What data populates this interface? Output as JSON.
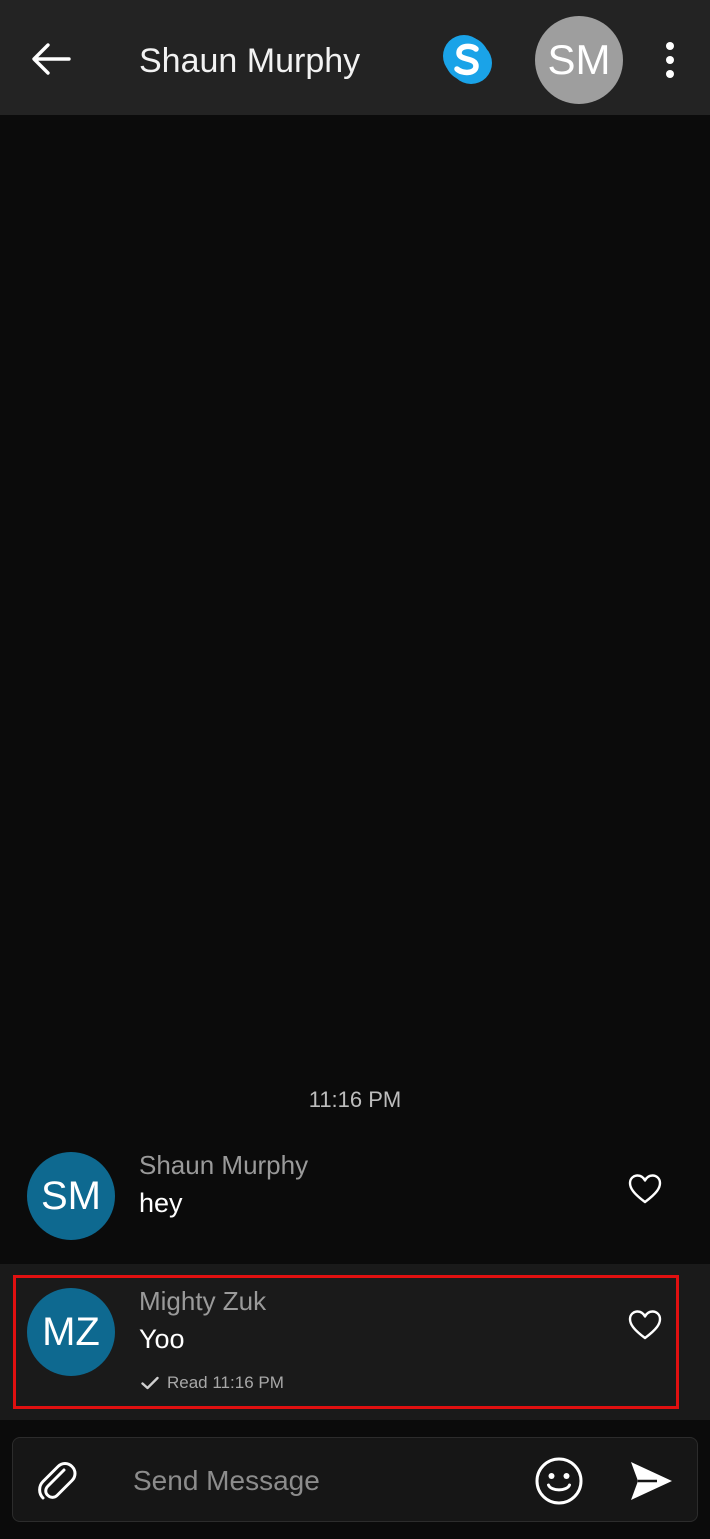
{
  "header": {
    "back_icon": "arrow-left-icon",
    "title": "Shaun Murphy",
    "skype_icon": "skype-logo-icon",
    "avatar_initials": "SM",
    "more_icon": "more-vertical-icon"
  },
  "conversation": {
    "time_divider": "11:16 PM",
    "messages": [
      {
        "sender": "Shaun Murphy",
        "avatar_initials": "SM",
        "text": "hey",
        "reaction_icon": "heart-outline-icon"
      },
      {
        "sender": "Mighty Zuk",
        "avatar_initials": "MZ",
        "text": "Yoo",
        "status": "Read 11:16 PM",
        "status_icon": "checkmark-icon",
        "reaction_icon": "heart-outline-icon"
      }
    ]
  },
  "composer": {
    "placeholder": "Send Message",
    "value": "",
    "attach_icon": "paperclip-icon",
    "emoji_icon": "smiley-icon",
    "send_icon": "send-icon"
  },
  "colors": {
    "background": "#0b0b0b",
    "header": "#232323",
    "avatar_blue": "#0e6990",
    "header_avatar_gray": "#9e9e9e",
    "skype_blue": "#1aa3e8",
    "highlight": "#e01010"
  }
}
